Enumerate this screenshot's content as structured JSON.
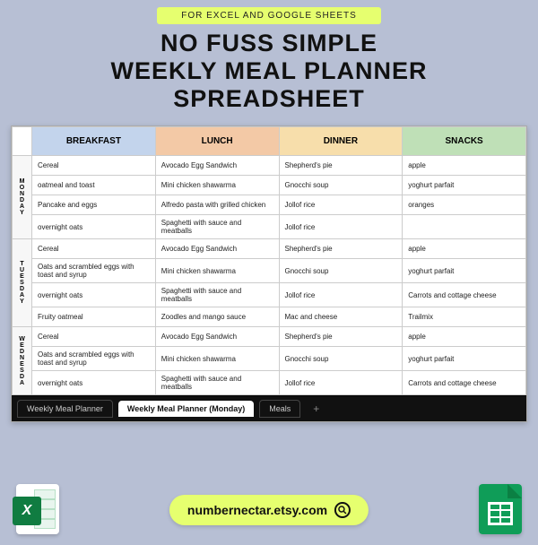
{
  "banner": "FOR EXCEL AND GOOGLE SHEETS",
  "title_line1": "NO FUSS SIMPLE",
  "title_line2": "WEEKLY MEAL PLANNER",
  "title_line3": "SPREADSHEET",
  "columns": {
    "breakfast": "BREAKFAST",
    "lunch": "LUNCH",
    "dinner": "DINNER",
    "snacks": "SNACKS"
  },
  "days": {
    "mon": {
      "label": "MONDAY",
      "rows": [
        {
          "b": "Cereal",
          "l": "Avocado Egg Sandwich",
          "d": "Shepherd's pie",
          "s": "apple"
        },
        {
          "b": "oatmeal and toast",
          "l": "Mini chicken shawarma",
          "d": "Gnocchi soup",
          "s": "yoghurt parfait"
        },
        {
          "b": "Pancake and eggs",
          "l": "Alfredo pasta with grilled chicken",
          "d": "Jollof rice",
          "s": "oranges"
        },
        {
          "b": "overnight oats",
          "l": "Spaghetti with sauce and meatballs",
          "d": "Jollof rice",
          "s": ""
        }
      ]
    },
    "tue": {
      "label": "TUESDAY",
      "rows": [
        {
          "b": "Cereal",
          "l": "Avocado Egg Sandwich",
          "d": "Shepherd's pie",
          "s": "apple"
        },
        {
          "b": "Oats and scrambled eggs with toast and syrup",
          "l": "Mini chicken shawarma",
          "d": "Gnocchi soup",
          "s": "yoghurt parfait"
        },
        {
          "b": "overnight oats",
          "l": "Spaghetti with sauce and meatballs",
          "d": "Jollof rice",
          "s": "Carrots and cottage cheese"
        },
        {
          "b": "Fruity oatmeal",
          "l": "Zoodles and mango sauce",
          "d": "Mac and cheese",
          "s": "Trailmix"
        }
      ]
    },
    "wed": {
      "label": "WEDNESDA",
      "rows": [
        {
          "b": "Cereal",
          "l": "Avocado Egg Sandwich",
          "d": "Shepherd's pie",
          "s": "apple"
        },
        {
          "b": "Oats and scrambled eggs with toast and syrup",
          "l": "Mini chicken shawarma",
          "d": "Gnocchi soup",
          "s": "yoghurt parfait"
        },
        {
          "b": "overnight oats",
          "l": "Spaghetti with sauce and meatballs",
          "d": "Jollof rice",
          "s": "Carrots and cottage cheese"
        }
      ]
    }
  },
  "tabs": {
    "t1": "Weekly Meal Planner",
    "t2": "Weekly Meal Planner (Monday)",
    "t3": "Meals",
    "plus": "+"
  },
  "footer_url": "numbernectar.etsy.com",
  "excel_x": "X"
}
